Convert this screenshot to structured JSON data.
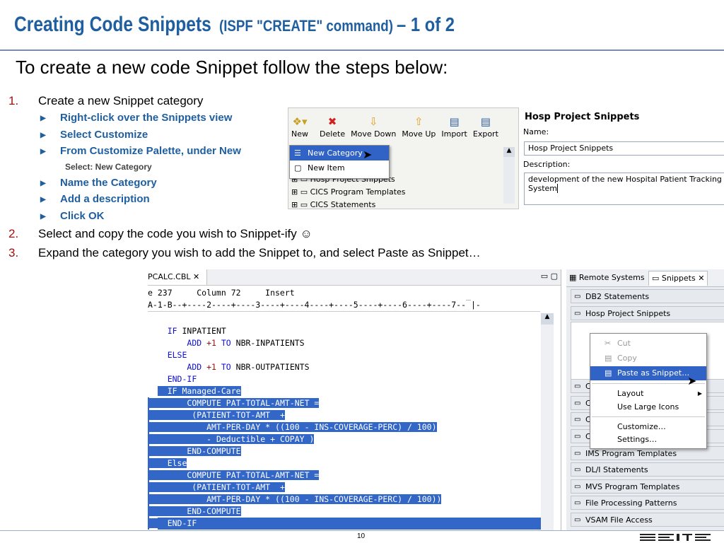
{
  "title": {
    "main": "Creating Code Snippets",
    "paren": "(ISPF \"CREATE\" command)",
    "suffix": "– 1 of 2"
  },
  "subtitle": "To create a new code Snippet follow the steps below:",
  "steps": [
    {
      "num": "1.",
      "text": "Create a new Snippet category"
    },
    {
      "num": "2.",
      "text": "Select and copy the code you wish to Snippet-ify ☺"
    },
    {
      "num": "3.",
      "text": "Expand the category you wish to add the Snippet to, and select Paste as Snippet…"
    }
  ],
  "bullets": [
    "Right-click over the Snippets view",
    "Select Customize",
    "From Customize Palette, under New",
    "Name the Category",
    "Add a description",
    "Click OK"
  ],
  "subnote": "Select:  New Category",
  "palette_toolbar": [
    "New",
    "Delete",
    "Move Down",
    "Move Up",
    "Import",
    "Export"
  ],
  "new_menu": [
    "New Category",
    "New Item"
  ],
  "palette_tree": [
    "Hosp Project Snippets",
    "CICS Program Templates",
    "CICS Statements"
  ],
  "category_form": {
    "heading": "Hosp Project Snippets",
    "name_label": "Name:",
    "name_value": "Hosp Project Snippets",
    "desc_label": "Description:",
    "desc_value_1": "development of the new Hospital Patient Tracking",
    "desc_value_2": "System"
  },
  "editor": {
    "tab": "PCALC.CBL",
    "status": "e 237     Column 72     Insert",
    "ruler": "A-1-B--+----2----+----3----+----4----+----5----+----6----+----7--",
    "ruler_tail": "|-"
  },
  "code_lines": [
    {
      "indent": "    ",
      "kw": "IF",
      "rest": " INPATIENT",
      "sel": false
    },
    {
      "indent": "        ",
      "kw": "ADD",
      "num": " +1",
      "kw2": " TO",
      "rest": " NBR-INPATIENTS",
      "sel": false
    },
    {
      "indent": "    ",
      "kw": "ELSE",
      "rest": "",
      "sel": false
    },
    {
      "indent": "        ",
      "kw": "ADD",
      "num": " +1",
      "kw2": " TO",
      "rest": " NBR-OUTPATIENTS",
      "sel": false
    },
    {
      "indent": "    ",
      "kw": "END-IF",
      "rest": "",
      "sel": false
    },
    {
      "indent": "    ",
      "text": "IF Managed-Care",
      "sel": "partial"
    },
    {
      "indent": "        ",
      "text": "COMPUTE PAT-TOTAL-AMT-NET =",
      "sel": "partial"
    },
    {
      "indent": "         ",
      "text": "(PATIENT-TOT-AMT  +",
      "sel": "partial"
    },
    {
      "indent": "            ",
      "text": "AMT-PER-DAY * ((100 - INS-COVERAGE-PERC) / 100)",
      "sel": "partial"
    },
    {
      "indent": "            ",
      "text": "- Deductible + COPAY )",
      "sel": "partial"
    },
    {
      "indent": "        ",
      "text": "END-COMPUTE",
      "sel": "partial"
    },
    {
      "indent": "    ",
      "text": "Else",
      "sel": "partial"
    },
    {
      "indent": "        ",
      "text": "COMPUTE PAT-TOTAL-AMT-NET =",
      "sel": "partial"
    },
    {
      "indent": "         ",
      "text": "(PATIENT-TOT-AMT  +",
      "sel": "partial"
    },
    {
      "indent": "            ",
      "text": "AMT-PER-DAY * ((100 - INS-COVERAGE-PERC) / 100))",
      "sel": "partial"
    },
    {
      "indent": "        ",
      "text": "END-COMPUTE",
      "sel": "partial"
    },
    {
      "indent": "    ",
      "text": "END-IF",
      "sel": "partial"
    }
  ],
  "snippets_view": {
    "tab_remote": "Remote Systems",
    "tab_snippets": "Snippets",
    "drawers_top": [
      "DB2 Statements",
      "Hosp Project Snippets"
    ],
    "drawers_hidden": [
      "C",
      "C",
      "C",
      "C"
    ],
    "drawers_bottom": [
      "IMS Program Templates",
      "DL/I Statements",
      "MVS Program Templates",
      "File Processing Patterns",
      "VSAM File Access"
    ]
  },
  "context_menu": {
    "cut": "Cut",
    "copy": "Copy",
    "paste": "Paste as Snippet…",
    "layout": "Layout",
    "large_icons": "Use Large Icons",
    "customize": "Customize…",
    "settings": "Settings…"
  },
  "page_number": "10"
}
